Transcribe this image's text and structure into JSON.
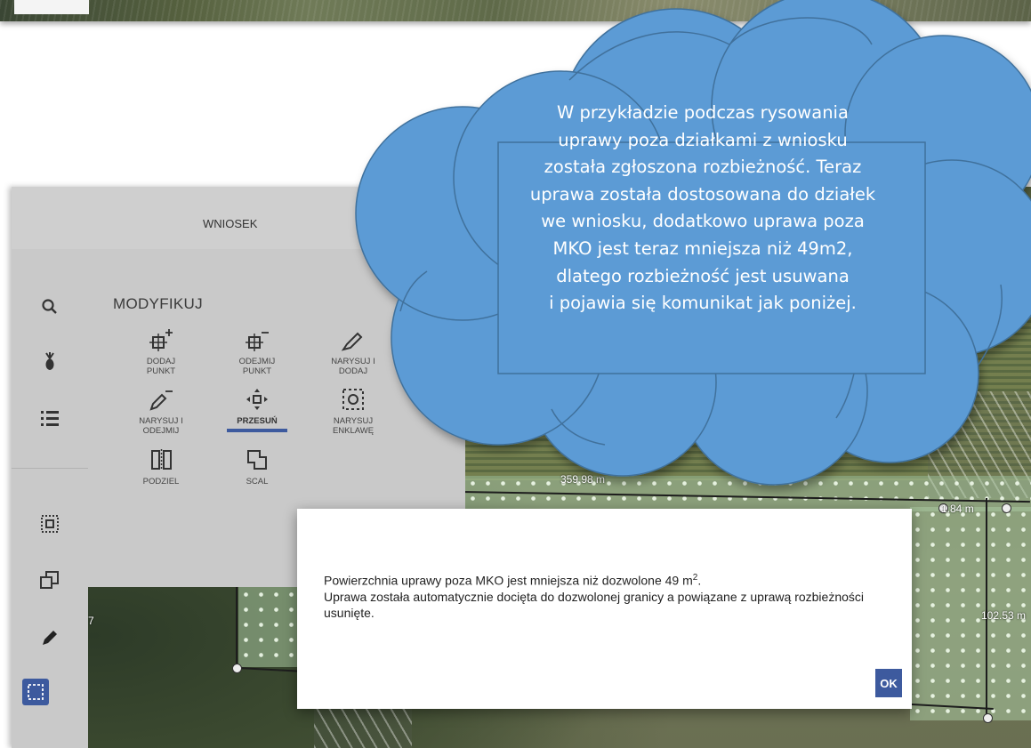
{
  "app": {
    "header_title": "WNIOSEK"
  },
  "sidebar": {
    "icons": [
      {
        "name": "search-icon"
      },
      {
        "name": "crop-icon"
      },
      {
        "name": "list-icon"
      },
      {
        "name": "select-area-icon"
      },
      {
        "name": "copy-icon"
      },
      {
        "name": "pencil-icon"
      },
      {
        "name": "draw-rectangle-icon",
        "active": true
      }
    ]
  },
  "tools": {
    "section_title": "MODYFIKUJ",
    "items": [
      {
        "label": "DODAJ\nPUNKT",
        "icon": "add-point-icon"
      },
      {
        "label": "ODEJMIJ\nPUNKT",
        "icon": "remove-point-icon"
      },
      {
        "label": "NARYSUJ I\nDODAJ",
        "icon": "draw-add-icon"
      },
      {
        "label": "NARYSUJ I\nODEJMIJ",
        "icon": "draw-subtract-icon"
      },
      {
        "label": "PRZESUŃ",
        "icon": "move-icon",
        "selected": true
      },
      {
        "label": "NARYSUJ\nENKLAWĘ",
        "icon": "enclave-icon"
      },
      {
        "label": "PODZIEL",
        "icon": "split-icon"
      },
      {
        "label": "SCAL",
        "icon": "merge-icon"
      }
    ]
  },
  "map": {
    "labels": {
      "distance_top": "359.98 m",
      "distance_right": "102.53 m",
      "left_edge": "7",
      "corner": "1.84 m"
    }
  },
  "dialog": {
    "line1_prefix": "Powierzchnia uprawy poza MKO jest mniejsza niż dozwolone 49 m",
    "line1_sup": "2",
    "line1_suffix": ".",
    "line2": "Uprawa została automatycznie docięta do dozwolonej granicy a powiązane z uprawą rozbieżności usunięte.",
    "ok_label": "OK"
  },
  "callout": {
    "lines": [
      "W przykładzie podczas rysowania",
      "uprawy poza działkami z wniosku",
      "została zgłoszona rozbieżność. Teraz",
      "uprawa została dostosowana do działek",
      "we wniosku, dodatkowo uprawa poza",
      "MKO jest teraz mniejsza niż 49m2,",
      "dlatego rozbieżność jest usuwana",
      "i pojawia się komunikat jak poniżej."
    ],
    "fill_color": "#5b9bd5",
    "stroke_color": "#41719c"
  }
}
